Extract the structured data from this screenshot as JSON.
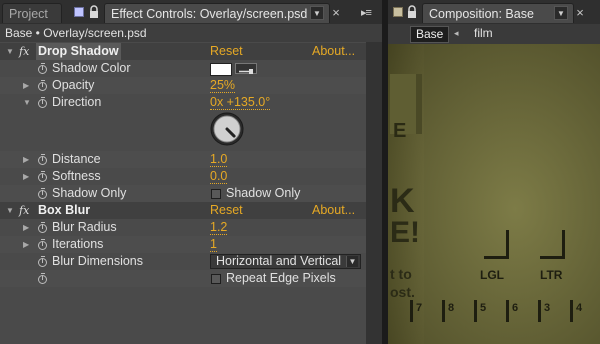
{
  "left_panel": {
    "tab_project": "Project",
    "tab_effect_controls": "Effect Controls: Overlay/screen.psd",
    "close_glyph": "×",
    "menu_glyph": "▸≡",
    "breadcrumb": "Base • Overlay/screen.psd"
  },
  "effects": {
    "drop_shadow": {
      "fx": "fx",
      "name": "Drop Shadow",
      "reset": "Reset",
      "about": "About...",
      "shadow_color": {
        "label": "Shadow Color",
        "color": "#ffffff"
      },
      "opacity": {
        "label": "Opacity",
        "value": "25%"
      },
      "direction": {
        "label": "Direction",
        "value": "0x +135.0°",
        "angle_deg": 135
      },
      "distance": {
        "label": "Distance",
        "value": "1.0"
      },
      "softness": {
        "label": "Softness",
        "value": "0.0"
      },
      "shadow_only": {
        "label": "Shadow Only",
        "checkbox_label": "Shadow Only"
      }
    },
    "box_blur": {
      "fx": "fx",
      "name": "Box Blur",
      "reset": "Reset",
      "about": "About...",
      "blur_radius": {
        "label": "Blur Radius",
        "value": "1.2"
      },
      "iterations": {
        "label": "Iterations",
        "value": "1"
      },
      "blur_dimensions": {
        "label": "Blur Dimensions",
        "value": "Horizontal and Vertical"
      },
      "repeat_edge": {
        "checkbox_label": "Repeat Edge Pixels"
      }
    }
  },
  "right_panel": {
    "tab_composition": "Composition: Base",
    "close_glyph": "×",
    "breadcrumb_base": "Base",
    "breadcrumb_arrow": "◂",
    "breadcrumb_film": "film",
    "overlay_text": {
      "side_letter": "E",
      "k": "K",
      "e": "E",
      "ex": "E!",
      "t_line": "t to",
      "ost_line": "ost.",
      "lgl": "LGL",
      "ltr": "LTR",
      "nums": [
        "7",
        "8",
        "5",
        "6",
        "3",
        "4"
      ]
    }
  },
  "colors": {
    "accent": "#e6a925",
    "panel_bg": "#4a4a4a",
    "comp_bg": "#6b6a3c"
  }
}
